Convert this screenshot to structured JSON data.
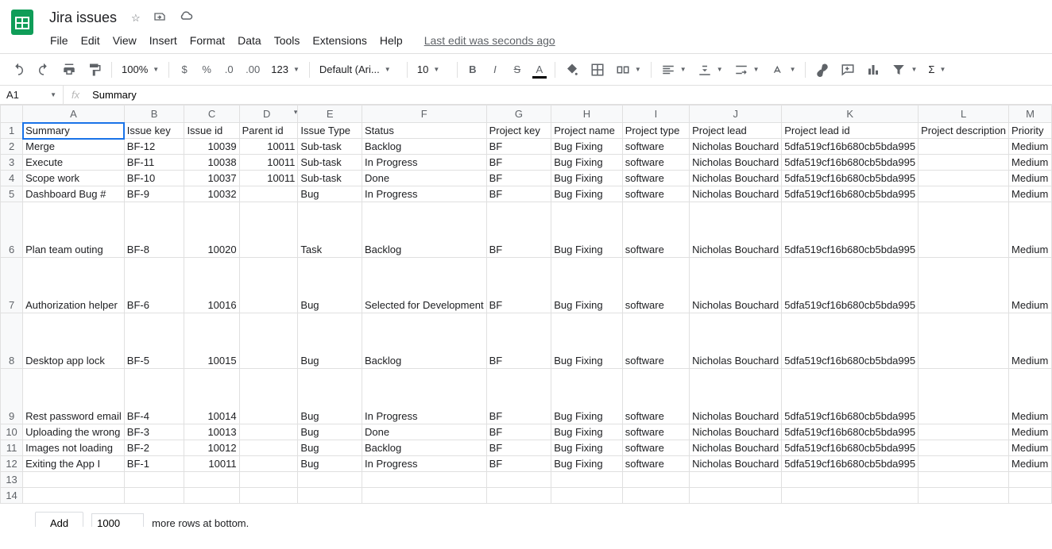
{
  "header": {
    "doc_title": "Jira issues",
    "menus": [
      "File",
      "Edit",
      "View",
      "Insert",
      "Format",
      "Data",
      "Tools",
      "Extensions",
      "Help"
    ],
    "last_edit": "Last edit was seconds ago"
  },
  "toolbar": {
    "zoom": "100%",
    "font": "Default (Ari...",
    "font_size": "10"
  },
  "formula_bar": {
    "name_box": "A1",
    "fx": "fx",
    "formula": "Summary"
  },
  "columns": [
    "A",
    "B",
    "C",
    "D",
    "E",
    "F",
    "G",
    "H",
    "I",
    "J",
    "K",
    "L",
    "M"
  ],
  "row_numbers": [
    "1",
    "2",
    "3",
    "4",
    "5",
    "6",
    "7",
    "8",
    "9",
    "10",
    "11",
    "12",
    "13",
    "14"
  ],
  "headers": {
    "A": "Summary",
    "B": "Issue key",
    "C": "Issue id",
    "D": "Parent id",
    "E": "Issue Type",
    "F": "Status",
    "G": "Project key",
    "H": "Project name",
    "I": "Project type",
    "J": "Project lead",
    "K": "Project lead id",
    "L": "Project description",
    "M": "Priority"
  },
  "rows": [
    {
      "A": "Merge",
      "B": "BF-12",
      "C": "10039",
      "D": "10011",
      "E": "Sub-task",
      "F": "Backlog",
      "G": "BF",
      "H": "Bug Fixing",
      "I": "software",
      "J": "Nicholas Bouchard",
      "K": "5dfa519cf16b680cb5bda995",
      "L": "",
      "M": "Medium",
      "tall": false
    },
    {
      "A": "Execute",
      "B": "BF-11",
      "C": "10038",
      "D": "10011",
      "E": "Sub-task",
      "F": "In Progress",
      "G": "BF",
      "H": "Bug Fixing",
      "I": "software",
      "J": "Nicholas Bouchard",
      "K": "5dfa519cf16b680cb5bda995",
      "L": "",
      "M": "Medium",
      "tall": false
    },
    {
      "A": "Scope work",
      "B": "BF-10",
      "C": "10037",
      "D": "10011",
      "E": "Sub-task",
      "F": "Done",
      "G": "BF",
      "H": "Bug Fixing",
      "I": "software",
      "J": "Nicholas Bouchard",
      "K": "5dfa519cf16b680cb5bda995",
      "L": "",
      "M": "Medium",
      "tall": false
    },
    {
      "A": "Dashboard Bug #",
      "B": "BF-9",
      "C": "10032",
      "D": "",
      "E": "Bug",
      "F": "In Progress",
      "G": "BF",
      "H": "Bug Fixing",
      "I": "software",
      "J": "Nicholas Bouchard",
      "K": "5dfa519cf16b680cb5bda995",
      "L": "",
      "M": "Medium",
      "tall": false
    },
    {
      "A": "Plan team outing",
      "B": "BF-8",
      "C": "10020",
      "D": "",
      "E": "Task",
      "F": "Backlog",
      "G": "BF",
      "H": "Bug Fixing",
      "I": "software",
      "J": "Nicholas Bouchard",
      "K": "5dfa519cf16b680cb5bda995",
      "L": "",
      "M": "Medium",
      "tall": true
    },
    {
      "A": "Authorization helper",
      "B": "BF-6",
      "C": "10016",
      "D": "",
      "E": "Bug",
      "F": "Selected for Development",
      "G": "BF",
      "H": "Bug Fixing",
      "I": "software",
      "J": "Nicholas Bouchard",
      "K": "5dfa519cf16b680cb5bda995",
      "L": "",
      "M": "Medium",
      "tall": true
    },
    {
      "A": "Desktop app lock",
      "B": "BF-5",
      "C": "10015",
      "D": "",
      "E": "Bug",
      "F": "Backlog",
      "G": "BF",
      "H": "Bug Fixing",
      "I": "software",
      "J": "Nicholas Bouchard",
      "K": "5dfa519cf16b680cb5bda995",
      "L": "",
      "M": "Medium",
      "tall": true
    },
    {
      "A": "Rest password email",
      "B": "BF-4",
      "C": "10014",
      "D": "",
      "E": "Bug",
      "F": "In Progress",
      "G": "BF",
      "H": "Bug Fixing",
      "I": "software",
      "J": "Nicholas Bouchard",
      "K": "5dfa519cf16b680cb5bda995",
      "L": "",
      "M": "Medium",
      "tall": true
    },
    {
      "A": "Uploading the wrong",
      "B": "BF-3",
      "C": "10013",
      "D": "",
      "E": "Bug",
      "F": "Done",
      "G": "BF",
      "H": "Bug Fixing",
      "I": "software",
      "J": "Nicholas Bouchard",
      "K": "5dfa519cf16b680cb5bda995",
      "L": "",
      "M": "Medium",
      "tall": false
    },
    {
      "A": "Images not loading",
      "B": "BF-2",
      "C": "10012",
      "D": "",
      "E": "Bug",
      "F": "Backlog",
      "G": "BF",
      "H": "Bug Fixing",
      "I": "software",
      "J": "Nicholas Bouchard",
      "K": "5dfa519cf16b680cb5bda995",
      "L": "",
      "M": "Medium",
      "tall": false
    },
    {
      "A": "Exiting the App I",
      "B": "BF-1",
      "C": "10011",
      "D": "",
      "E": "Bug",
      "F": "In Progress",
      "G": "BF",
      "H": "Bug Fixing",
      "I": "software",
      "J": "Nicholas Bouchard",
      "K": "5dfa519cf16b680cb5bda995",
      "L": "",
      "M": "Medium",
      "tall": false
    }
  ],
  "add_rows": {
    "button": "Add",
    "count": "1000",
    "suffix": "more rows at bottom."
  }
}
